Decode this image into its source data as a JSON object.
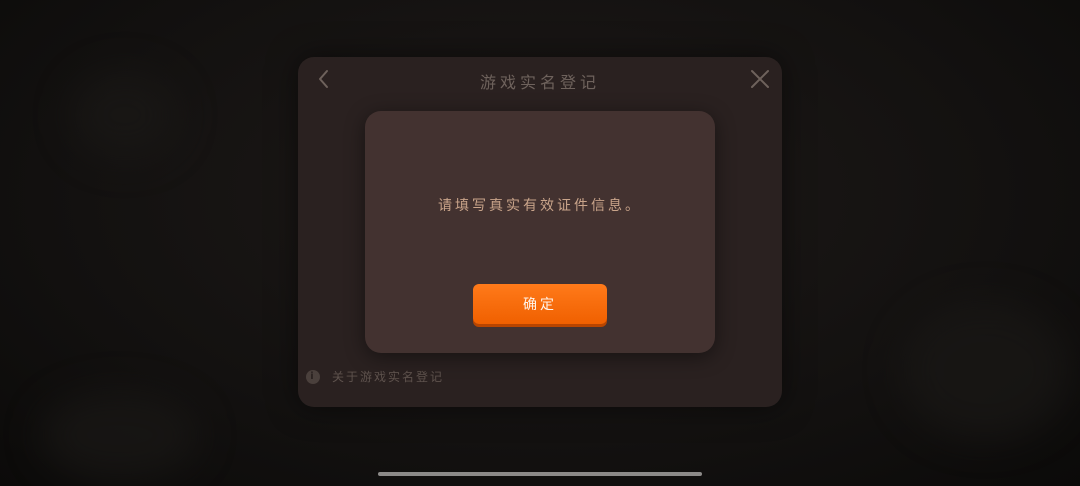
{
  "panel": {
    "title": "游戏实名登记",
    "back_icon": "chevron-left-icon",
    "close_icon": "close-icon",
    "footer_link": "关于游戏实名登记",
    "footer_icon": "info-icon"
  },
  "dialog": {
    "message": "请填写真实有效证件信息。",
    "confirm_label": "确定"
  },
  "colors": {
    "accent": "#ff7a1a",
    "dialog_bg": "#433230",
    "panel_bg": "#2a2120",
    "message_text": "#c9a48a"
  }
}
